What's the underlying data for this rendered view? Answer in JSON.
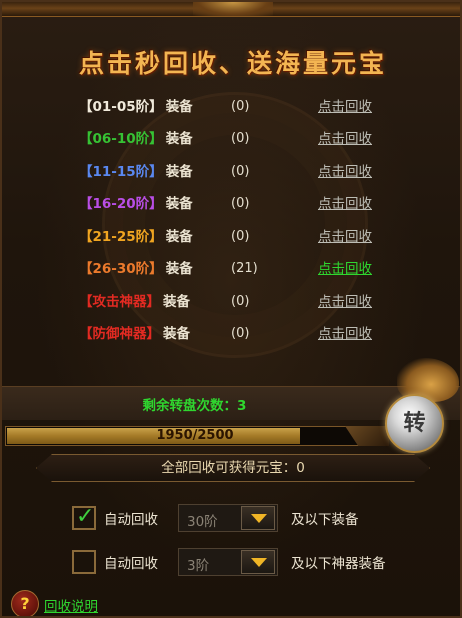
{
  "title": "点击秒回收、送海量元宝",
  "rows": [
    {
      "range": "【01-05阶】",
      "suffix": "装备",
      "count": "(0)",
      "link": "点击回收",
      "color": "#f1eadb"
    },
    {
      "range": "【06-10阶】",
      "suffix": "装备",
      "count": "(0)",
      "link": "点击回收",
      "color": "#36c234"
    },
    {
      "range": "【11-15阶】",
      "suffix": "装备",
      "count": "(0)",
      "link": "点击回收",
      "color": "#5a88f0"
    },
    {
      "range": "【16-20阶】",
      "suffix": "装备",
      "count": "(0)",
      "link": "点击回收",
      "color": "#b94ee6"
    },
    {
      "range": "【21-25阶】",
      "suffix": "装备",
      "count": "(0)",
      "link": "点击回收",
      "color": "#f0a521"
    },
    {
      "range": "【26-30阶】",
      "suffix": "装备",
      "count": "(21)",
      "link": "点击回收",
      "color": "#ec7a2c"
    },
    {
      "range": "【攻击神器】",
      "suffix": "装备",
      "count": "(0)",
      "link": "点击回收",
      "color": "#e22a22"
    },
    {
      "range": "【防御神器】",
      "suffix": "装备",
      "count": "(0)",
      "link": "点击回收",
      "color": "#e22a22"
    }
  ],
  "spins_text": "剩余转盘次数：3",
  "progress": {
    "text": "1950/2500",
    "current": 1950,
    "max": 2500
  },
  "spin_button_label": "转",
  "gain_text": "全部回收可获得元宝：0",
  "options": [
    {
      "checked": true,
      "label": "自动回收",
      "value": "30阶",
      "suffix": "及以下装备"
    },
    {
      "checked": false,
      "label": "自动回收",
      "value": "3阶",
      "suffix": "及以下神器装备"
    }
  ],
  "help": {
    "icon": "?",
    "label": "回收说明"
  },
  "colors": {
    "accent_green": "#2fd62f",
    "gold": "#f3b552"
  }
}
